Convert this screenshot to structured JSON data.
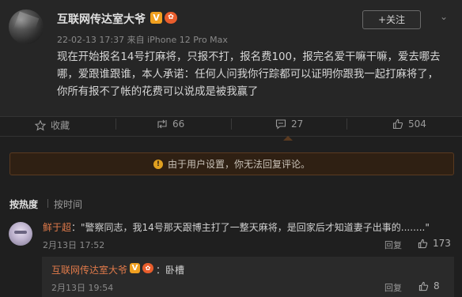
{
  "post": {
    "username": "互联网传达室大爷",
    "badge_v": "V",
    "badge_level": "✿",
    "meta": "22-02-13 17:37 来自 iPhone 12 Pro Max",
    "follow_label": "+关注",
    "text": "现在开始报名14号打麻将，只报不打，报名费100，报完名爱干嘛干嘛，爱去哪去哪，爱跟谁跟谁，本人承诺：任何人问我你行踪都可以证明你跟我一起打麻将了，你所有报不了帐的花费可以说成是被我赢了"
  },
  "actions": {
    "favorite_label": "收藏",
    "repost_count": "66",
    "comment_count": "27",
    "like_count": "504"
  },
  "notice": {
    "text": "由于用户设置，你无法回复评论。"
  },
  "sort": {
    "hot": "按热度",
    "time": "按时间"
  },
  "comment": {
    "user": "鲜于超",
    "text": "：\"警察同志，我14号那天跟博主打了一整天麻将，是回家后才知道妻子出事的........\"",
    "time": "2月13日 17:52",
    "reply_label": "回复",
    "like_count": "173"
  },
  "reply": {
    "user": "互联网传达室大爷",
    "badge_v": "V",
    "badge_level": "✿",
    "text": "：卧槽",
    "time": "2月13日 19:54",
    "reply_label": "回复",
    "like_count": "8"
  },
  "colors": {
    "accent": "#e07a4a",
    "notice_bg": "#2f2013",
    "bg": "#1f1f1f"
  }
}
